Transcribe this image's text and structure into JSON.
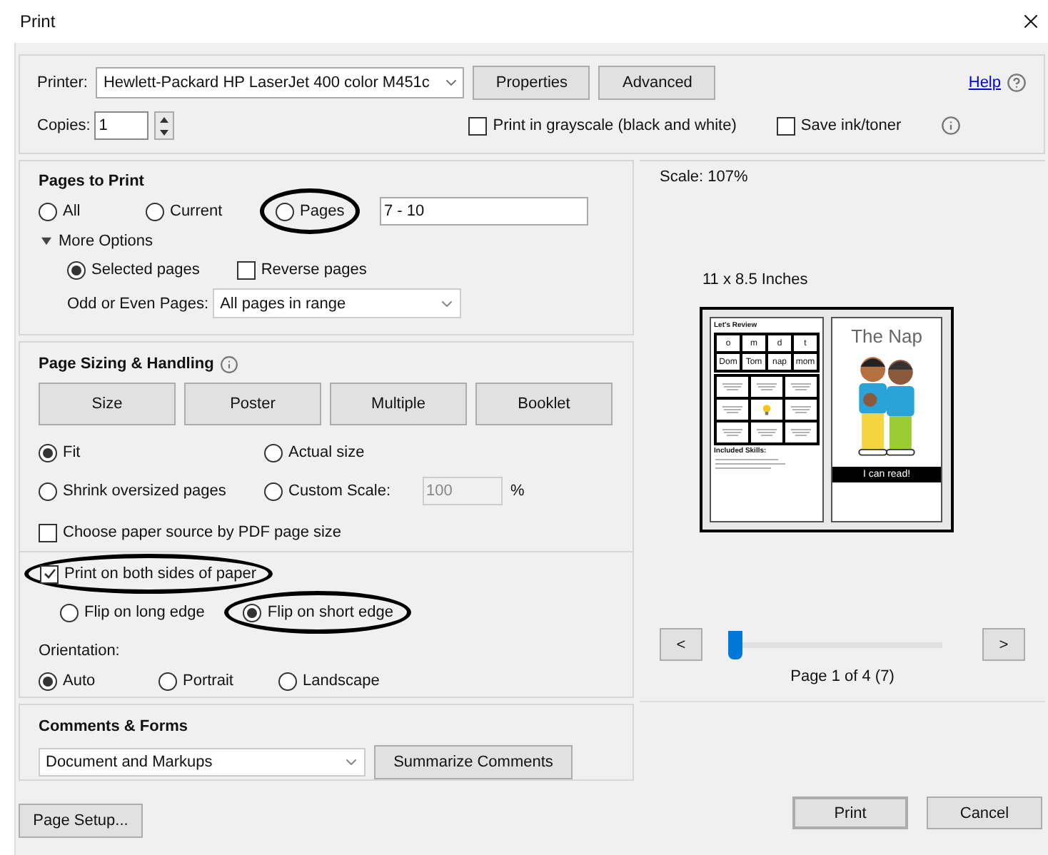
{
  "window": {
    "title": "Print"
  },
  "printer": {
    "label": "Printer:",
    "value": "Hewlett-Packard HP LaserJet 400 color M451c",
    "buttons": [
      "Properties",
      "Advanced"
    ]
  },
  "help": {
    "link": "Help"
  },
  "copies": {
    "label": "Copies:",
    "value": "1"
  },
  "options": [
    {
      "label": "Print in grayscale (black and white)",
      "checked": false
    },
    {
      "label": "Save ink/toner",
      "checked": false
    }
  ],
  "pages_to_print": {
    "title": "Pages to Print",
    "range": [
      {
        "label": "All",
        "selected": false
      },
      {
        "label": "Current",
        "selected": false
      },
      {
        "label": "Pages",
        "selected": false
      }
    ],
    "pages_value": "7 - 10",
    "more_options": {
      "label": "More Options",
      "expanded": true
    },
    "subset": {
      "label": "Selected pages",
      "selected": true
    },
    "reverse": {
      "label": "Reverse pages",
      "checked": false
    },
    "odd_even": {
      "label": "Odd or Even Pages:",
      "value": "All pages in range"
    }
  },
  "page_sizing": {
    "title": "Page Sizing & Handling",
    "modes": [
      "Size",
      "Poster",
      "Multiple",
      "Booklet"
    ],
    "scaling": [
      {
        "label": "Fit",
        "selected": true
      },
      {
        "label": "Actual size",
        "selected": false
      },
      {
        "label": "Shrink oversized pages",
        "selected": false
      },
      {
        "label": "Custom Scale:",
        "selected": false
      }
    ],
    "custom_scale": {
      "value": "100",
      "unit": "%",
      "disabled": true
    },
    "paper_source": {
      "label": "Choose paper source by PDF page size",
      "checked": false
    }
  },
  "duplex": {
    "label": "Print on both sides of paper",
    "checked": true,
    "flip": [
      {
        "label": "Flip on long edge",
        "selected": false
      },
      {
        "label": "Flip on short edge",
        "selected": true
      }
    ]
  },
  "orientation": {
    "label": "Orientation:",
    "options": [
      {
        "label": "Auto",
        "selected": true
      },
      {
        "label": "Portrait",
        "selected": false
      },
      {
        "label": "Landscape",
        "selected": false
      }
    ]
  },
  "comments_forms": {
    "title": "Comments & Forms",
    "value": "Document and Markups",
    "button": "Summarize Comments"
  },
  "page_setup": "Page Setup...",
  "preview": {
    "scale": "Scale: 107%",
    "paper": "11 x 8.5 Inches",
    "left_page": {
      "title": "Let's Review",
      "letters": [
        "o",
        "m",
        "d",
        "t"
      ],
      "words": [
        "Dom",
        "Tom",
        "nap",
        "mom"
      ],
      "skills": "Included Skills:"
    },
    "right_page": {
      "title": "The Nap",
      "banner": "I can read!"
    },
    "prev": "<",
    "next": ">",
    "slider": {
      "level": 0
    },
    "page_label": "Page 1 of 4 (7)"
  },
  "actions": [
    {
      "label": "Print",
      "default": true
    },
    {
      "label": "Cancel",
      "default": false
    }
  ]
}
